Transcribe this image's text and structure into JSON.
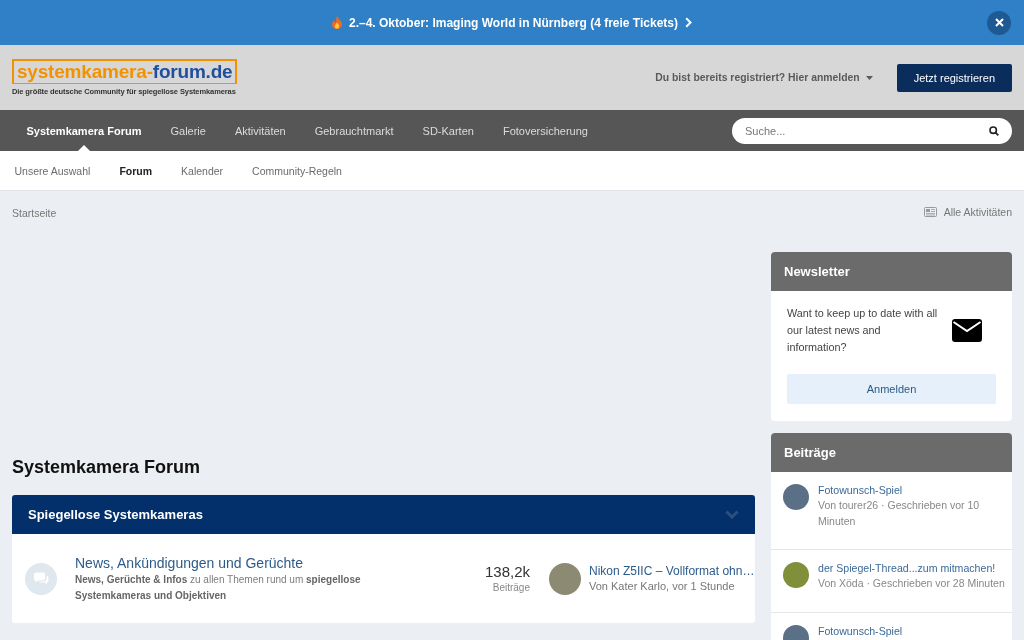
{
  "announcement": {
    "text": "2.–4. Oktober: Imaging World in Nürnberg (4 freie Tickets)"
  },
  "header": {
    "logo": {
      "parts": [
        {
          "text": "systemkamera-",
          "color": "#f39200"
        },
        {
          "text": "forum.de",
          "color": "#1f4f9d"
        }
      ],
      "tagline": "Die größte deutsche Community für spiegellose Systemkameras"
    },
    "login_link": "Du bist bereits registriert? Hier anmelden",
    "register_button": "Jetzt registrieren"
  },
  "main_nav": [
    {
      "label": "Systemkamera Forum",
      "selected": true
    },
    {
      "label": "Galerie",
      "selected": false
    },
    {
      "label": "Aktivitäten",
      "selected": false
    },
    {
      "label": "Gebrauchtmarkt",
      "selected": false
    },
    {
      "label": "SD-Karten",
      "selected": false
    },
    {
      "label": "Fotoversicherung",
      "selected": false
    }
  ],
  "search": {
    "placeholder": "Suche..."
  },
  "sub_nav": [
    {
      "label": "Unsere Auswahl",
      "selected": false
    },
    {
      "label": "Forum",
      "selected": true
    },
    {
      "label": "Kalender",
      "selected": false
    },
    {
      "label": "Community-Regeln",
      "selected": false
    }
  ],
  "breadcrumb": [
    "Startseite"
  ],
  "activity_link": "Alle Aktivitäten",
  "page_title": "Systemkamera Forum",
  "categories": [
    {
      "title": "Spiegellose Systemkameras",
      "expanded": true,
      "forums": [
        {
          "title": "News, Ankündigungen und Gerüchte",
          "description": "**News, Gerüchte & Infos** zu allen Themen rund um **spiegellose Systemkameras und Objektiven**",
          "count": "138,2k",
          "count_label": "Beiträge",
          "last_post": {
            "title": "Nikon Z5IIC – Vollformat ohn…",
            "meta": "Von Kater Karlo, vor 1 Stunde"
          }
        }
      ]
    }
  ],
  "sidebar": {
    "newsletter": {
      "title": "Newsletter",
      "text": "Want to keep up to date with all our latest news and information?",
      "button": "Anmelden"
    },
    "posts": {
      "title": "Beiträge",
      "items": [
        {
          "title": "Fotowunsch-Spiel",
          "meta": "Von tourer26 · Geschrieben vor 10 Minuten"
        },
        {
          "title": "der Spiegel-Thread...zum mitmachen!",
          "meta": "Von Xöda · Geschrieben vor 28 Minuten"
        },
        {
          "title": "Fotowunsch-Spiel"
        }
      ]
    }
  }
}
